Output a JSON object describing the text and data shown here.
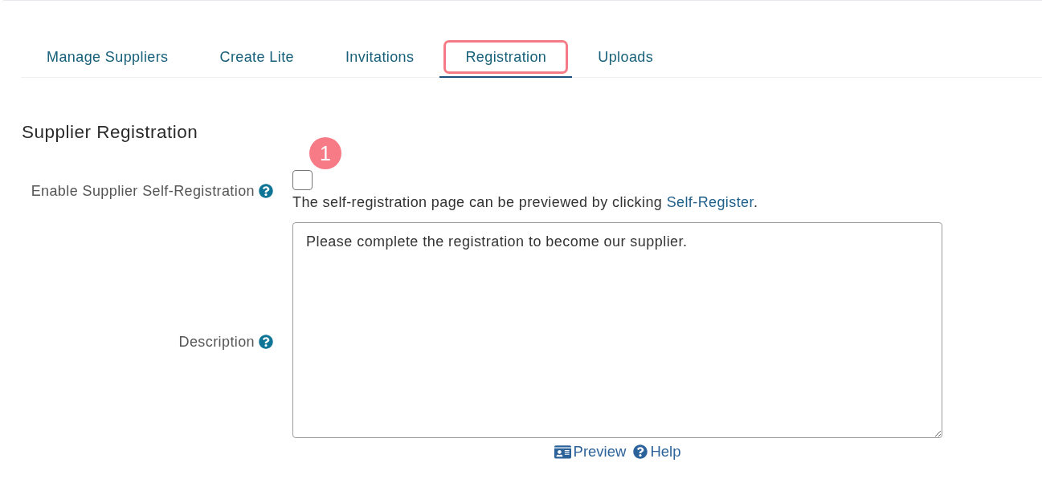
{
  "tabs": [
    {
      "label": "Manage Suppliers",
      "selected": false,
      "highlighted": false
    },
    {
      "label": "Create Lite",
      "selected": false,
      "highlighted": false
    },
    {
      "label": "Invitations",
      "selected": false,
      "highlighted": false
    },
    {
      "label": "Registration",
      "selected": true,
      "highlighted": true
    },
    {
      "label": "Uploads",
      "selected": false,
      "highlighted": false
    }
  ],
  "section_title": "Supplier Registration",
  "fields": [
    {
      "kind": "checkbox",
      "label": "Enable Supplier Self-Registration",
      "help": true,
      "checked": false,
      "badge": "1",
      "note": "The self-registration page can be previewed by clicking",
      "link": "Self-Register",
      "note_end": "."
    },
    {
      "kind": "textarea",
      "label": "Description",
      "help": true,
      "value": "Please complete the registration to become our supplier.",
      "actions": [
        {
          "kind": "preview",
          "label": "Preview"
        },
        {
          "kind": "help",
          "label": "Help"
        }
      ]
    }
  ]
}
